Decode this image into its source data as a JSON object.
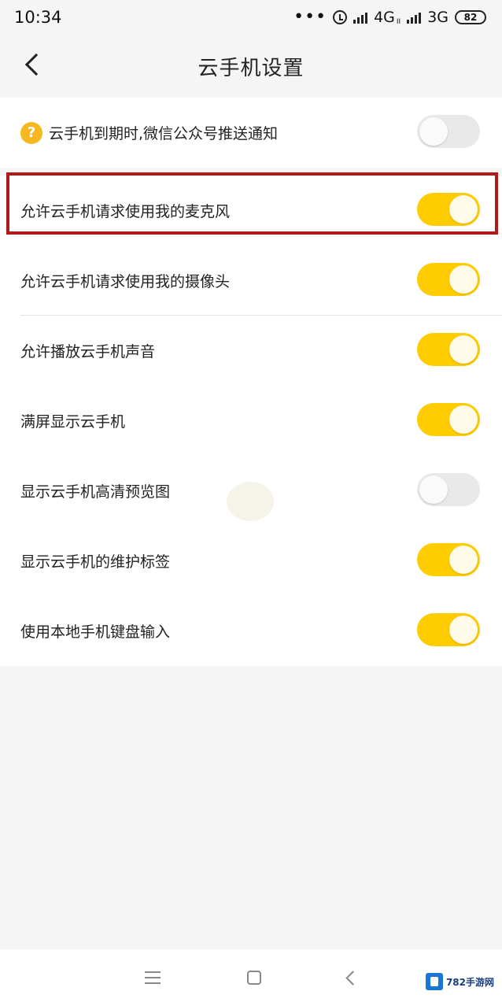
{
  "status_bar": {
    "time": "10:34",
    "dots": "•••",
    "network_1": "4G",
    "network_1_sub": "II",
    "network_2": "3G",
    "battery": "82"
  },
  "header": {
    "title": "云手机设置"
  },
  "settings": [
    {
      "label": "云手机到期时,微信公众号推送通知",
      "enabled": false,
      "has_help": true
    },
    {
      "label": "允许云手机请求使用我的麦克风",
      "enabled": true
    },
    {
      "label": "允许云手机请求使用我的摄像头",
      "enabled": true
    },
    {
      "label": "允许播放云手机声音",
      "enabled": true
    },
    {
      "label": "满屏显示云手机",
      "enabled": true
    },
    {
      "label": "显示云手机高清预览图",
      "enabled": false
    },
    {
      "label": "显示云手机的维护标签",
      "enabled": true
    },
    {
      "label": "使用本地手机键盘输入",
      "enabled": true
    }
  ],
  "help_icon_glyph": "?",
  "logo": {
    "text": "782手游网"
  },
  "colors": {
    "toggle_on": "#ffcc00",
    "toggle_off": "#e9e9e9",
    "help_icon": "#f5b91f",
    "highlight_border": "#b01a1a"
  }
}
